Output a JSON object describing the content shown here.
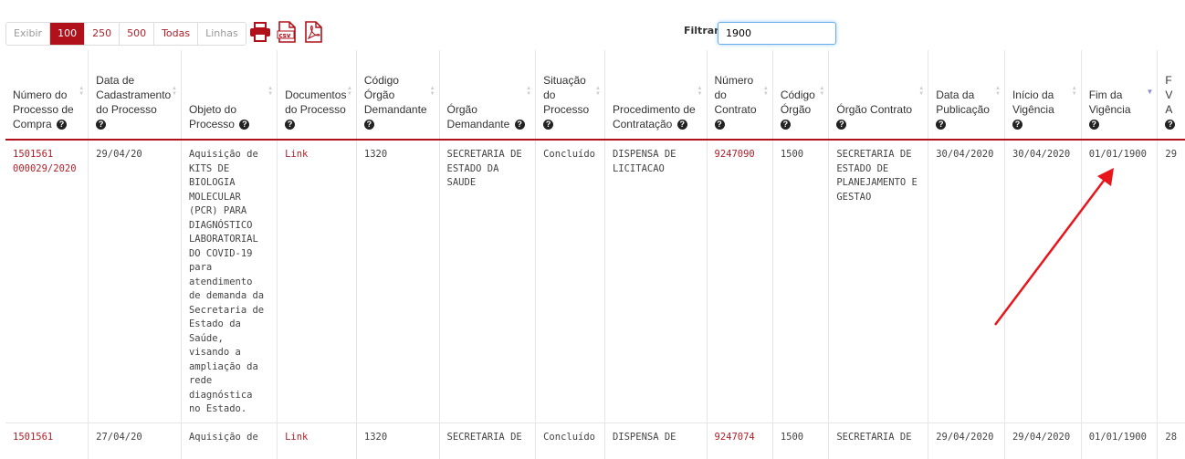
{
  "toolbar": {
    "show_label": "Exibir",
    "lengths": [
      "100",
      "250",
      "500",
      "Todas"
    ],
    "lines_label": "Linhas",
    "export_icons": [
      "print-icon",
      "csv-icon",
      "pdf-icon"
    ],
    "filter_label": "Filtrar:",
    "filter_value": "1900"
  },
  "columns": [
    "Número do Processo de Compra",
    "Data de Cadastramento do Processo",
    "Objeto do Processo",
    "Documentos do Processo",
    "Código Órgão Demandante",
    "Órgão Demandante",
    "Situação do Processo",
    "Procedimento de Contratação",
    "Número do Contrato",
    "Código Órgão",
    "Órgão Contrato",
    "Data da Publicação",
    "Início da Vigência",
    "Fim da Vigência",
    "F V A"
  ],
  "rows": [
    [
      "1501561 000029/2020",
      "29/04/20",
      "Aquisição de KITS DE BIOLOGIA MOLECULAR (PCR) PARA DIAGNÓSTICO LABORATORIAL DO COVID-19 para atendimento de demanda da Secretaria de Estado da Saúde, visando a ampliação da rede diagnóstica no Estado.",
      "Link",
      "1320",
      "SECRETARIA DE ESTADO DA SAUDE",
      "Concluído",
      "DISPENSA DE LICITACAO",
      "9247090",
      "1500",
      "SECRETARIA DE ESTADO DE PLANEJAMENTO E GESTAO",
      "30/04/2020",
      "30/04/2020",
      "01/01/1900",
      "29"
    ],
    [
      "1501561",
      "27/04/20",
      "Aquisição de",
      "Link",
      "1320",
      "SECRETARIA DE",
      "Concluído",
      "DISPENSA DE",
      "9247074",
      "1500",
      "SECRETARIA DE",
      "29/04/2020",
      "29/04/2020",
      "01/01/1900",
      "28"
    ]
  ],
  "colors": {
    "accent": "#b0111a",
    "link": "#b0202a",
    "arrow": "#e8161b"
  }
}
